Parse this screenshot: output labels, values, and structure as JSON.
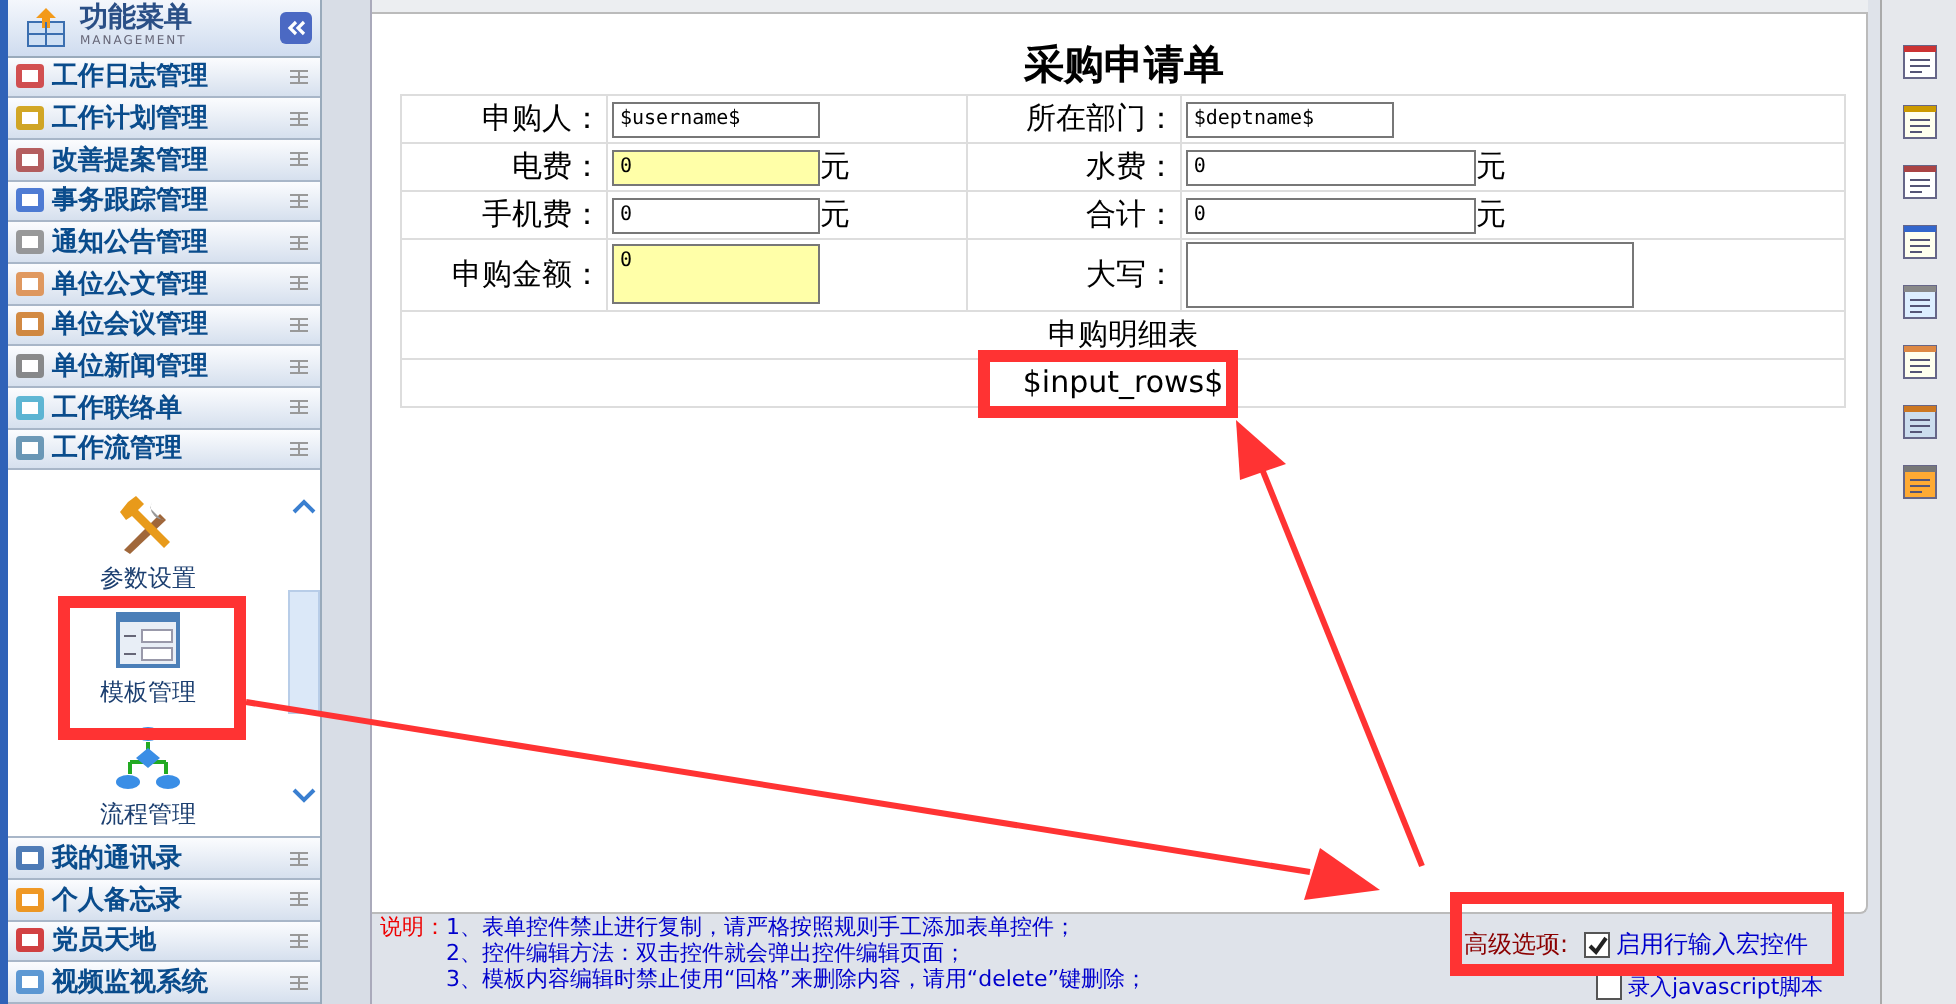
{
  "sidebar": {
    "title": "功能菜单",
    "subtitle": "MANAGEMENT",
    "items_top": [
      {
        "label": "工作日志管理"
      },
      {
        "label": "工作计划管理"
      },
      {
        "label": "改善提案管理"
      },
      {
        "label": "事务跟踪管理"
      },
      {
        "label": "通知公告管理"
      },
      {
        "label": "单位公文管理"
      },
      {
        "label": "单位会议管理"
      },
      {
        "label": "单位新闻管理"
      },
      {
        "label": "工作联络单"
      },
      {
        "label": "工作流管理"
      }
    ],
    "panel_items": [
      {
        "label": "参数设置",
        "kind": "tools"
      },
      {
        "label": "模板管理",
        "kind": "template"
      },
      {
        "label": "流程管理",
        "kind": "flow"
      }
    ],
    "items_bottom": [
      {
        "label": "我的通讯录"
      },
      {
        "label": "个人备忘录"
      },
      {
        "label": "党员天地"
      },
      {
        "label": "视频监视系统"
      }
    ]
  },
  "form": {
    "title": "采购申请单",
    "rows": [
      {
        "cells": [
          {
            "label": "申购人：",
            "value": "$username$",
            "highlighted": false
          },
          {
            "label": "所在部门：",
            "value": "$deptname$",
            "highlighted": false
          }
        ]
      },
      {
        "cells": [
          {
            "label": "电费：",
            "value": "0",
            "highlighted": true,
            "unit": "元"
          },
          {
            "label": "水费：",
            "value": "0",
            "highlighted": false,
            "unit": "元"
          }
        ]
      },
      {
        "cells": [
          {
            "label": "手机费：",
            "value": "0",
            "highlighted": false,
            "unit": "元"
          },
          {
            "label": "合计：",
            "value": "0",
            "highlighted": false,
            "unit": "元"
          }
        ]
      },
      {
        "cells": [
          {
            "label": "申购金额：",
            "value": "0",
            "highlighted": true,
            "kind": "multiline"
          },
          {
            "label": "大写：",
            "highlighted": false,
            "kind": "multiline"
          }
        ]
      }
    ],
    "detail_title": "申购明细表",
    "macro": "$input_rows$"
  },
  "notes": {
    "label": "说明：",
    "lines": [
      "1、表单控件禁止进行复制，请严格按照规则手工添加表单控件；",
      "2、控件编辑方法：双击控件就会弹出控件编辑页面；",
      "3、模板内容编辑时禁止使用“回格”来删除内容，请用“delete”键删除；"
    ]
  },
  "advanced": {
    "label": "高级选项:",
    "options": [
      {
        "label": "启用行输入宏控件",
        "checked": true
      },
      {
        "label": "录入javascript脚本",
        "checked": false
      }
    ]
  }
}
